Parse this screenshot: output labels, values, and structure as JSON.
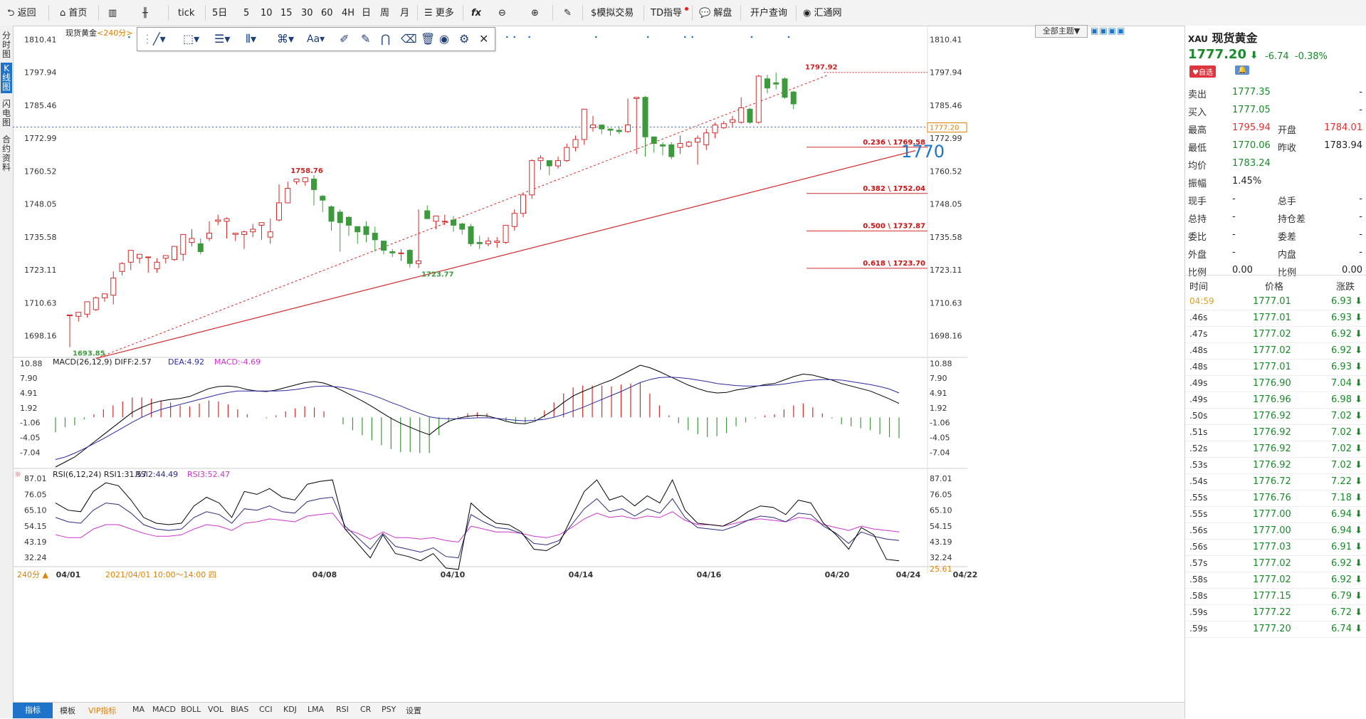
{
  "toolbar": {
    "items": [
      {
        "label": "返回",
        "icon": "back-arrow-icon"
      },
      {
        "label": "首页",
        "icon": "home-icon"
      },
      {
        "label": "",
        "icon": "bar-chart-icon"
      },
      {
        "label": "",
        "icon": "candlestick-icon"
      },
      {
        "label": "tick"
      },
      {
        "label": "5日"
      },
      {
        "label": "5"
      },
      {
        "label": "10"
      },
      {
        "label": "15"
      },
      {
        "label": "30"
      },
      {
        "label": "60"
      },
      {
        "label": "4H"
      },
      {
        "label": "日"
      },
      {
        "label": "周"
      },
      {
        "label": "月"
      },
      {
        "label": "更多",
        "icon": "list-icon"
      },
      {
        "label": "fx",
        "icon": "formula-icon"
      },
      {
        "label": "",
        "icon": "zoom-out-icon"
      },
      {
        "label": "",
        "icon": "zoom-in-icon"
      },
      {
        "label": "",
        "icon": "pen-icon"
      },
      {
        "label": "$模拟交易"
      },
      {
        "label": "TD指导"
      },
      {
        "label": "解盘",
        "icon": "chat-icon"
      },
      {
        "label": "开户查询"
      },
      {
        "label": "汇通网",
        "icon": "logo-icon"
      }
    ]
  },
  "left_tabs": [
    "分时图",
    "K线图",
    "闪电图",
    "合约资料"
  ],
  "chart_header": {
    "title": "现货黄金",
    "period": "<240分>"
  },
  "theme_button": "全部主题▼",
  "bottom_tabs": [
    "指标",
    "模板",
    "VIP指标",
    "MA",
    "MACD",
    "BOLL",
    "VOL",
    "BIAS",
    "CCI",
    "KDJ",
    "LMA",
    "RSI",
    "CR",
    "PSY",
    "设置"
  ],
  "period_badge": "240分 ▲",
  "date_readout": "2021/04/01 10:00～14:00 四",
  "chart_data": {
    "type": "candlestick",
    "price_axis": {
      "ticks": [
        1810.41,
        1797.94,
        1785.46,
        1772.99,
        1760.52,
        1748.05,
        1735.58,
        1723.11,
        1710.63,
        1698.16
      ],
      "range": [
        1690.2,
        1813.5
      ]
    },
    "x_labels": [
      {
        "i": 0,
        "label": "04/01"
      },
      {
        "i": 20,
        "label": "04/08"
      },
      {
        "i": 30,
        "label": "04/10"
      },
      {
        "i": 40,
        "label": "04/14"
      },
      {
        "i": 50,
        "label": "04/16"
      },
      {
        "i": 60,
        "label": "04/20"
      },
      {
        "i": 70,
        "label": "04/22"
      },
      {
        "i": 80,
        "label": "04/24"
      }
    ],
    "candles": [
      [
        1706.0,
        1706.0,
        1693.85,
        1705.5
      ],
      [
        1705.5,
        1707.0,
        1703.5,
        1706.3
      ],
      [
        1706.3,
        1711.0,
        1705.0,
        1708.0
      ],
      [
        1708.0,
        1712.5,
        1707.5,
        1713.0
      ],
      [
        1712.5,
        1714.0,
        1711.0,
        1713.5
      ],
      [
        1713.5,
        1720.0,
        1710.0,
        1722.5
      ],
      [
        1722.5,
        1725.5,
        1721.0,
        1726.0
      ],
      [
        1726.0,
        1730.5,
        1723.0,
        1727.5
      ],
      [
        1727.5,
        1729.0,
        1725.5,
        1728.5
      ],
      [
        1728.0,
        1728.0,
        1722.0,
        1723.0
      ],
      [
        1723.5,
        1726.0,
        1722.0,
        1727.5
      ],
      [
        1727.5,
        1728.5,
        1725.5,
        1726.5
      ],
      [
        1727.0,
        1732.0,
        1726.5,
        1729.0
      ],
      [
        1729.0,
        1736.5,
        1726.5,
        1733.5
      ],
      [
        1733.5,
        1735.0,
        1732.0,
        1738.5
      ],
      [
        1733.0,
        1730.0,
        1729.0,
        1735.0
      ],
      [
        1735.0,
        1737.0,
        1734.0,
        1741.5
      ],
      [
        1741.5,
        1742.0,
        1740.0,
        1744.0
      ],
      [
        1741.5,
        1742.5,
        1735.0,
        1743.0
      ],
      [
        1736.5,
        1737.0,
        1734.0,
        1737.0
      ],
      [
        1736.5,
        1737.5,
        1731.0,
        1738.0
      ],
      [
        1737.5,
        1738.5,
        1735.5,
        1740.5
      ],
      [
        1740.0,
        1741.0,
        1734.5,
        1735.0
      ],
      [
        1735.5,
        1737.5,
        1733.0,
        1742.5
      ],
      [
        1742.0,
        1748.5,
        1741.5,
        1755.5
      ],
      [
        1748.5,
        1754.0,
        1758.76,
        1756.5
      ],
      [
        1756.5,
        1757.5,
        1755.5,
        1757.0
      ],
      [
        1756.5,
        1758.0,
        1755.0,
        1758.0
      ],
      [
        1757.5,
        1753.5,
        1747.5,
        1759.0
      ],
      [
        1751.0,
        1749.5,
        1745.0,
        1751.5
      ],
      [
        1747.0,
        1741.5,
        1738.0,
        1747.5
      ],
      [
        1745.0,
        1741.0,
        1730.0,
        1746.0
      ],
      [
        1743.0,
        1740.0,
        1736.0,
        1743.5
      ],
      [
        1739.5,
        1737.5,
        1733.0,
        1739.0
      ],
      [
        1739.5,
        1736.5,
        1733.5,
        1741.5
      ],
      [
        1737.0,
        1734.5,
        1730.0,
        1739.5
      ],
      [
        1734.0,
        1730.5,
        1729.0,
        1733.5
      ],
      [
        1730.0,
        1729.5,
        1728.0,
        1731.0
      ],
      [
        1729.5,
        1729.5,
        1726.5,
        1731.0
      ],
      [
        1730.5,
        1725.5,
        1724.0,
        1731.0
      ],
      [
        1725.5,
        1726.5,
        1723.77,
        1746.0
      ],
      [
        1745.5,
        1742.5,
        1743.0,
        1747.5
      ],
      [
        1741.5,
        1743.5,
        1738.5,
        1743.5
      ],
      [
        1741.5,
        1741.5,
        1740.0,
        1744.0
      ],
      [
        1742.0,
        1740.0,
        1737.5,
        1743.5
      ],
      [
        1740.5,
        1738.5,
        1736.5,
        1741.0
      ],
      [
        1739.5,
        1733.0,
        1732.0,
        1740.5
      ],
      [
        1733.5,
        1733.0,
        1731.0,
        1736.0
      ],
      [
        1733.0,
        1734.0,
        1732.0,
        1735.5
      ],
      [
        1733.5,
        1734.0,
        1731.5,
        1735.5
      ],
      [
        1733.5,
        1740.0,
        1733.0,
        1740.0
      ],
      [
        1739.5,
        1744.5,
        1738.0,
        1746.0
      ],
      [
        1744.5,
        1751.5,
        1743.0,
        1752.0
      ],
      [
        1751.5,
        1764.5,
        1750.0,
        1765.0
      ],
      [
        1764.5,
        1765.5,
        1761.0,
        1766.5
      ],
      [
        1764.5,
        1762.5,
        1759.0,
        1764.5
      ],
      [
        1762.5,
        1764.5,
        1761.5,
        1766.0
      ],
      [
        1764.5,
        1769.5,
        1764.0,
        1771.0
      ],
      [
        1769.5,
        1772.5,
        1768.0,
        1774.0
      ],
      [
        1772.5,
        1784.0,
        1770.5,
        1777.0
      ],
      [
        1777.0,
        1778.0,
        1775.5,
        1781.5
      ],
      [
        1778.0,
        1776.5,
        1774.5,
        1778.0
      ],
      [
        1776.5,
        1776.0,
        1774.0,
        1776.5
      ],
      [
        1776.0,
        1775.5,
        1774.5,
        1777.5
      ],
      [
        1775.5,
        1778.0,
        1775.0,
        1788.0
      ],
      [
        1788.0,
        1788.5,
        1767.0,
        1788.5
      ],
      [
        1788.5,
        1773.5,
        1766.0,
        1789.0
      ],
      [
        1773.5,
        1771.0,
        1767.5,
        1772.5
      ],
      [
        1770.5,
        1770.0,
        1766.5,
        1771.5
      ],
      [
        1770.5,
        1766.0,
        1765.0,
        1771.5
      ],
      [
        1769.5,
        1771.0,
        1767.0,
        1774.0
      ],
      [
        1770.0,
        1771.5,
        1769.5,
        1772.0
      ],
      [
        1771.5,
        1773.0,
        1763.0,
        1774.0
      ],
      [
        1770.5,
        1775.0,
        1768.5,
        1776.5
      ],
      [
        1775.0,
        1778.0,
        1773.0,
        1779.0
      ],
      [
        1777.0,
        1778.5,
        1776.5,
        1779.5
      ],
      [
        1779.0,
        1780.0,
        1777.0,
        1781.5
      ],
      [
        1779.0,
        1784.5,
        1778.5,
        1788.5
      ],
      [
        1784.0,
        1779.0,
        1778.5,
        1784.5
      ],
      [
        1779.0,
        1796.5,
        1778.5,
        1797.0
      ],
      [
        1795.5,
        1792.0,
        1790.0,
        1797.0
      ],
      [
        1794.0,
        1793.5,
        1791.5,
        1797.92
      ],
      [
        1795.5,
        1788.5,
        1788.0,
        1796.0
      ],
      [
        1790.5,
        1786.0,
        1784.0,
        1791.0
      ]
    ],
    "annotations": [
      {
        "label": "1797.92",
        "value": 1797.92
      },
      {
        "label": "1758.76",
        "value": 1758.76
      },
      {
        "label": "1723.77",
        "value": 1723.77
      },
      {
        "label": "1693.85",
        "value": 1693.85
      }
    ],
    "fib_levels": [
      {
        "label": "0.236 \\ 1769.58",
        "value": 1769.58
      },
      {
        "label": "0.382 \\ 1752.04",
        "value": 1752.04
      },
      {
        "label": "0.500 \\ 1737.87",
        "value": 1737.87
      },
      {
        "label": "0.618 \\ 1723.70",
        "value": 1723.7
      }
    ],
    "current_price": 1777.2,
    "current_price_label": "1777.20",
    "big_label": "1770",
    "macd": {
      "header": {
        "name": "MACD(26,12,9)",
        "diff": "DIFF:2.57",
        "dea": "DEA:4.92",
        "macd": "MACD:-4.69"
      },
      "ticks": [
        10.88,
        7.9,
        4.91,
        1.92,
        -1.06,
        -4.05,
        -7.04
      ],
      "range": [
        -10.0,
        11.5
      ],
      "diff": [
        -10,
        -9,
        -8,
        -6.5,
        -5,
        -3.5,
        -2,
        -0.5,
        1,
        2,
        2.8,
        3.3,
        3.6,
        3.8,
        4.2,
        5,
        5.8,
        6.2,
        6.3,
        6.1,
        5.6,
        5.3,
        5.2,
        5.5,
        6,
        6.5,
        7,
        7.2,
        6.9,
        6.2,
        5.3,
        4.3,
        3.3,
        2.2,
        1,
        -0.2,
        -1.2,
        -2,
        -2.8,
        -3.5,
        -2,
        -0.8,
        -0.2,
        0.2,
        0.4,
        0.3,
        -0.2,
        -0.8,
        -1.2,
        -1.3,
        -0.8,
        0.3,
        1.5,
        3,
        4.3,
        5.2,
        6,
        6.8,
        7.5,
        8.5,
        9.5,
        10.5,
        10,
        9.2,
        8.3,
        7.4,
        6.5,
        5.8,
        5.2,
        4.9,
        5,
        5.5,
        5.8,
        6.2,
        6.6,
        6.8,
        7.5,
        8.2,
        8.7,
        8.5,
        8,
        7.5,
        6.8,
        6.3,
        5.8,
        5.3,
        4.5,
        3.7,
        2.8
      ],
      "dea": [
        -8.5,
        -8.0,
        -7.2,
        -6.3,
        -5.3,
        -4.3,
        -3.2,
        -2.1,
        -1.0,
        0.0,
        0.9,
        1.6,
        2.1,
        2.6,
        3.1,
        3.6,
        4.1,
        4.6,
        5.0,
        5.3,
        5.3,
        5.3,
        5.3,
        5.3,
        5.4,
        5.6,
        5.9,
        6.2,
        6.3,
        6.2,
        6.0,
        5.6,
        5.1,
        4.5,
        3.8,
        3.0,
        2.3,
        1.5,
        0.8,
        0.1,
        -0.2,
        -0.3,
        -0.3,
        -0.2,
        -0.1,
        -0.1,
        -0.2,
        -0.4,
        -0.6,
        -0.7,
        -0.6,
        -0.4,
        0.0,
        0.6,
        1.3,
        2.0,
        2.8,
        3.6,
        4.4,
        5.2,
        6.1,
        7.0,
        7.6,
        8.0,
        8.1,
        8.0,
        7.8,
        7.5,
        7.2,
        6.8,
        6.6,
        6.4,
        6.3,
        6.3,
        6.4,
        6.5,
        6.7,
        7.0,
        7.3,
        7.5,
        7.6,
        7.6,
        7.5,
        7.2,
        6.9,
        6.6,
        6.2,
        5.7,
        4.9
      ]
    },
    "rsi": {
      "header": {
        "name": "RSI(6,12,24)",
        "rsi1": "RSI1:31.57",
        "rsi2": "RSI2:44.49",
        "rsi3": "RSI3:52.47"
      },
      "ticks": [
        87.01,
        76.05,
        65.1,
        54.15,
        43.19,
        32.24
      ],
      "extra_tick": "25.61",
      "range": [
        21,
        91
      ],
      "rsi1": [
        70,
        65,
        64,
        78,
        84,
        82,
        72,
        60,
        56,
        55,
        56,
        68,
        74,
        70,
        60,
        78,
        76,
        80,
        74,
        72,
        83,
        85,
        86,
        52,
        42,
        32,
        48,
        35,
        33,
        30,
        35,
        25,
        24,
        70,
        62,
        56,
        55,
        50,
        38,
        37,
        42,
        60,
        78,
        86,
        72,
        75,
        68,
        75,
        70,
        86,
        65,
        56,
        55,
        54,
        58,
        64,
        68,
        67,
        62,
        72,
        70,
        56,
        48,
        38,
        53,
        48,
        31,
        30
      ],
      "rsi2": [
        60,
        57,
        56,
        65,
        70,
        69,
        63,
        55,
        52,
        51,
        52,
        60,
        64,
        62,
        56,
        66,
        65,
        68,
        64,
        63,
        71,
        73,
        74,
        54,
        46,
        38,
        49,
        40,
        38,
        36,
        39,
        33,
        32,
        62,
        57,
        53,
        52,
        49,
        42,
        41,
        44,
        55,
        66,
        73,
        64,
        66,
        61,
        66,
        63,
        73,
        60,
        53,
        52,
        51,
        54,
        58,
        61,
        60,
        57,
        63,
        62,
        54,
        49,
        42,
        50,
        47,
        45,
        44
      ],
      "rsi3": [
        48,
        46,
        46,
        52,
        55,
        55,
        52,
        49,
        47,
        47,
        48,
        52,
        55,
        54,
        51,
        56,
        57,
        59,
        58,
        57,
        61,
        62,
        63,
        52,
        49,
        45,
        50,
        46,
        46,
        45,
        46,
        44,
        43,
        54,
        52,
        50,
        50,
        49,
        47,
        46,
        48,
        53,
        59,
        63,
        60,
        61,
        59,
        61,
        60,
        64,
        58,
        55,
        55,
        54,
        56,
        58,
        59,
        58,
        57,
        60,
        59,
        55,
        53,
        51,
        54,
        52,
        51,
        50
      ]
    }
  },
  "right_panel": {
    "symbol_code": "XAU",
    "symbol_name": "现货黄金",
    "price": "1777.20",
    "change": "-6.74",
    "change_pct": "-0.38%",
    "fav_label": "♥自选",
    "quote_rows": [
      {
        "l1": "卖出",
        "v1": "1777.35",
        "l2": "",
        "v2": "-"
      },
      {
        "l1": "买入",
        "v1": "1777.05",
        "l2": "",
        "v2": "-"
      },
      {
        "l1": "最高",
        "v1": "1795.94",
        "l2": "开盘",
        "v2": "1784.01"
      },
      {
        "l1": "最低",
        "v1": "1770.06",
        "l2": "昨收",
        "v2": "1783.94"
      },
      {
        "l1": "均价",
        "v1": "1783.24",
        "l2": "",
        "v2": ""
      },
      {
        "l1": "振幅",
        "v1": "1.45%",
        "l2": "",
        "v2": ""
      },
      {
        "l1": "现手",
        "v1": "-",
        "l2": "总手",
        "v2": "-"
      },
      {
        "l1": "总持",
        "v1": "-",
        "l2": "持仓差",
        "v2": "-"
      },
      {
        "l1": "委比",
        "v1": "-",
        "l2": "委差",
        "v2": "-"
      },
      {
        "l1": "外盘",
        "v1": "-",
        "l2": "内盘",
        "v2": "-"
      },
      {
        "l1": "比例",
        "v1": "0.00",
        "l2": "比例",
        "v2": "0.00"
      }
    ],
    "tick_header": {
      "time": "时间",
      "price": "价格",
      "change": "涨跌"
    },
    "ticks": [
      {
        "t": "04:59",
        "p": "1777.01",
        "c": "6.93"
      },
      {
        "t": ".46s",
        "p": "1777.01",
        "c": "6.93"
      },
      {
        "t": ".47s",
        "p": "1777.02",
        "c": "6.92"
      },
      {
        "t": ".48s",
        "p": "1777.02",
        "c": "6.92"
      },
      {
        "t": ".48s",
        "p": "1777.01",
        "c": "6.93"
      },
      {
        "t": ".49s",
        "p": "1776.90",
        "c": "7.04"
      },
      {
        "t": ".49s",
        "p": "1776.96",
        "c": "6.98"
      },
      {
        "t": ".50s",
        "p": "1776.92",
        "c": "7.02"
      },
      {
        "t": ".51s",
        "p": "1776.92",
        "c": "7.02"
      },
      {
        "t": ".52s",
        "p": "1776.92",
        "c": "7.02"
      },
      {
        "t": ".53s",
        "p": "1776.92",
        "c": "7.02"
      },
      {
        "t": ".54s",
        "p": "1776.72",
        "c": "7.22"
      },
      {
        "t": ".55s",
        "p": "1776.76",
        "c": "7.18"
      },
      {
        "t": ".55s",
        "p": "1777.00",
        "c": "6.94"
      },
      {
        "t": ".56s",
        "p": "1777.00",
        "c": "6.94"
      },
      {
        "t": ".56s",
        "p": "1777.03",
        "c": "6.91"
      },
      {
        "t": ".57s",
        "p": "1777.02",
        "c": "6.92"
      },
      {
        "t": ".58s",
        "p": "1777.02",
        "c": "6.92"
      },
      {
        "t": ".58s",
        "p": "1777.15",
        "c": "6.79"
      },
      {
        "t": ".59s",
        "p": "1777.22",
        "c": "6.72"
      },
      {
        "t": ".59s",
        "p": "1777.20",
        "c": "6.74"
      }
    ]
  },
  "colors": {
    "up": "#d42a2a",
    "down": "#3c9a3c",
    "trend": "#d42a2a",
    "diff": "#000000",
    "dea": "#2b2ba0",
    "rsi1": "#000000",
    "rsi2": "#2b2b80",
    "rsi3": "#cc33cc",
    "accent": "#1e74c9"
  }
}
